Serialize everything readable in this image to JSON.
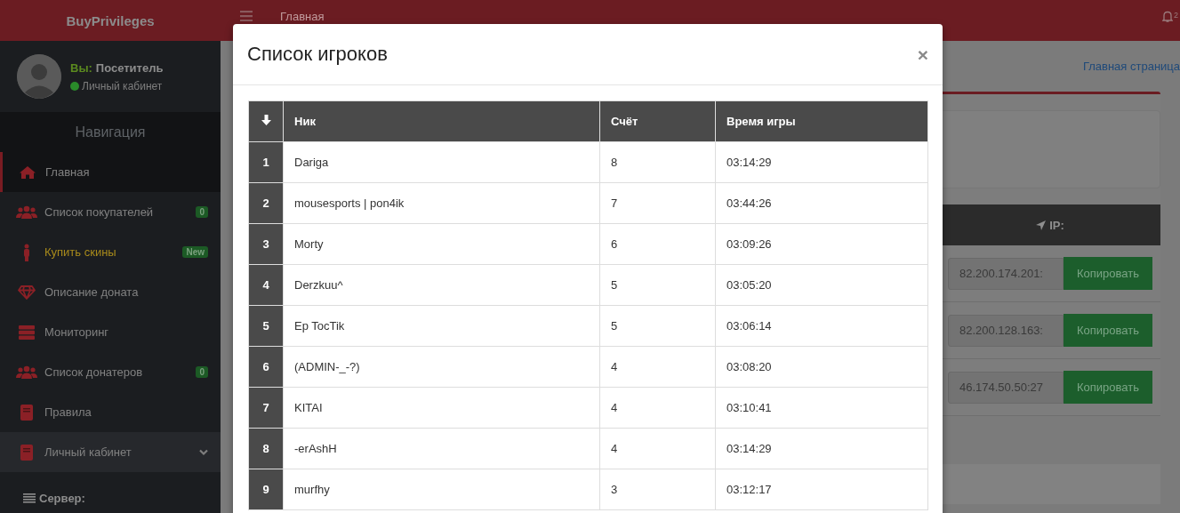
{
  "app": {
    "brand": "BuyPrivileges"
  },
  "user": {
    "prefix": "Вы:",
    "name": "Посетитель",
    "status": "Личный кабинет",
    "online": true
  },
  "sidebar": {
    "heading": "Навигация",
    "items": [
      {
        "label": "Главная",
        "selected": true,
        "highlighted": false
      },
      {
        "label": "Список покупателей",
        "selected": false,
        "highlighted": false,
        "badge": "0"
      },
      {
        "label": "Купить скины",
        "selected": false,
        "highlighted": true,
        "badge": "New"
      },
      {
        "label": "Описание доната",
        "selected": false,
        "highlighted": false
      },
      {
        "label": "Мониторинг",
        "selected": false,
        "highlighted": false
      },
      {
        "label": "Список донатеров",
        "selected": false,
        "highlighted": false,
        "badge": "0"
      },
      {
        "label": "Правила",
        "selected": false,
        "highlighted": false
      },
      {
        "label": "Личный кабинет",
        "selected": false,
        "highlighted": false,
        "expanded": true
      }
    ],
    "submenu_heading": "Сервер:"
  },
  "topbar": {
    "breadcrumb": "Главная",
    "notification_count": "2"
  },
  "page": {
    "breadcrumb_link": "Главная страница",
    "servers_table": {
      "column": "IP:",
      "rows": [
        {
          "address": "82.200.174.201:",
          "button": "Копировать"
        },
        {
          "address": "82.200.128.163:",
          "button": "Копировать"
        },
        {
          "address": "46.174.50.50:27",
          "button": "Копировать"
        }
      ]
    }
  },
  "modal": {
    "title": "Список игроков",
    "close": "×",
    "columns": [
      "Ник",
      "Счёт",
      "Время игры"
    ],
    "rows": [
      {
        "rank": "1",
        "nick": "Dariga",
        "score": "8",
        "time": "03:14:29"
      },
      {
        "rank": "2",
        "nick": "mousesports | pon4ik",
        "score": "7",
        "time": "03:44:26"
      },
      {
        "rank": "3",
        "nick": "Morty",
        "score": "6",
        "time": "03:09:26"
      },
      {
        "rank": "4",
        "nick": "Derzkuu^",
        "score": "5",
        "time": "03:05:20"
      },
      {
        "rank": "5",
        "nick": "Ep TocTik",
        "score": "5",
        "time": "03:06:14"
      },
      {
        "rank": "6",
        "nick": "(ADMIN-_-?)",
        "score": "4",
        "time": "03:08:20"
      },
      {
        "rank": "7",
        "nick": "KITAI",
        "score": "4",
        "time": "03:10:41"
      },
      {
        "rank": "8",
        "nick": "-erAshH",
        "score": "4",
        "time": "03:14:29"
      },
      {
        "rank": "9",
        "nick": "murfhy",
        "score": "3",
        "time": "03:12:17"
      }
    ]
  }
}
